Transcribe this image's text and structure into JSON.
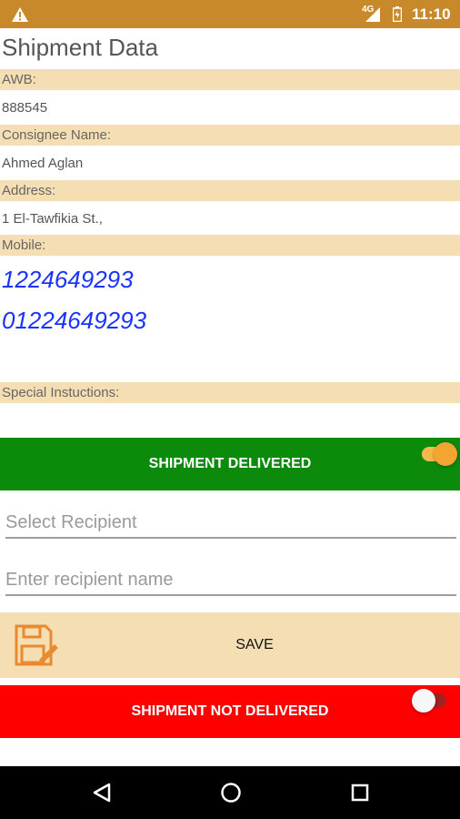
{
  "status_bar": {
    "network": "4G",
    "time": "11:10",
    "color": "#c8892a"
  },
  "page": {
    "title": "Shipment Data"
  },
  "fields": {
    "awb_label": "AWB:",
    "awb_value": "888545",
    "consignee_label": "Consignee Name:",
    "consignee_value": "Ahmed Aglan",
    "address_label": "Address:",
    "address_value": "1 El-Tawfikia St.,",
    "mobile_label": "Mobile:",
    "mobiles": [
      "1224649293",
      "01224649293"
    ],
    "special_label": "Special Instuctions:"
  },
  "delivered": {
    "label": "SHIPMENT DELIVERED",
    "toggle_on": true,
    "color": "#0b8a0b"
  },
  "recipient": {
    "select_placeholder": "Select Recipient",
    "name_placeholder": "Enter recipient name"
  },
  "save": {
    "label": "SAVE",
    "icon": "floppy-pencil-icon"
  },
  "not_delivered": {
    "label": "SHIPMENT NOT DELIVERED",
    "toggle_on": false,
    "color": "#ff0000"
  },
  "nav": {
    "back_icon": "back-triangle-icon",
    "home_icon": "home-circle-icon",
    "recents_icon": "recents-square-icon"
  }
}
